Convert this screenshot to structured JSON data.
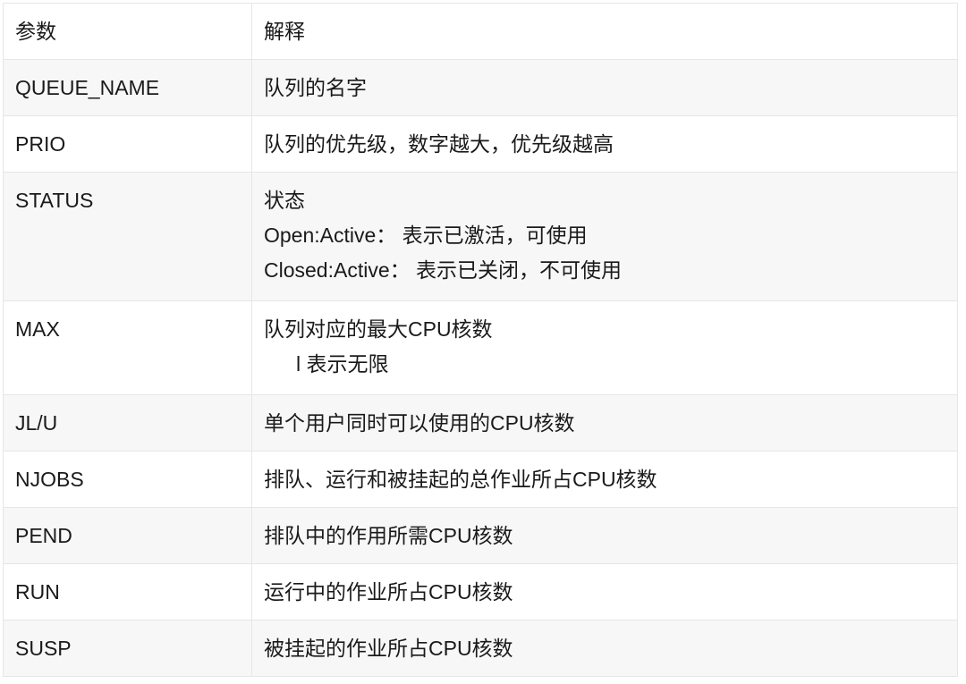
{
  "header": {
    "param": "参数",
    "desc": "解释"
  },
  "rows": [
    {
      "param": "QUEUE_NAME",
      "lines": [
        "队列的名字"
      ]
    },
    {
      "param": "PRIO",
      "lines": [
        "队列的优先级，数字越大，优先级越高"
      ]
    },
    {
      "param": "STATUS",
      "lines": [
        "状态",
        "Open:Active： 表示已激活，可使用",
        "Closed:Active： 表示已关闭，不可使用"
      ]
    },
    {
      "param": "MAX",
      "lines": [
        "队列对应的最大CPU核数",
        "l 表示无限"
      ]
    },
    {
      "param": "JL/U",
      "lines": [
        "单个用户同时可以使用的CPU核数"
      ]
    },
    {
      "param": "NJOBS",
      "lines": [
        "排队、运行和被挂起的总作业所占CPU核数"
      ]
    },
    {
      "param": "PEND",
      "lines": [
        "排队中的作用所需CPU核数"
      ]
    },
    {
      "param": "RUN",
      "lines": [
        "运行中的作业所占CPU核数"
      ]
    },
    {
      "param": "SUSP",
      "lines": [
        "被挂起的作业所占CPU核数"
      ]
    }
  ]
}
